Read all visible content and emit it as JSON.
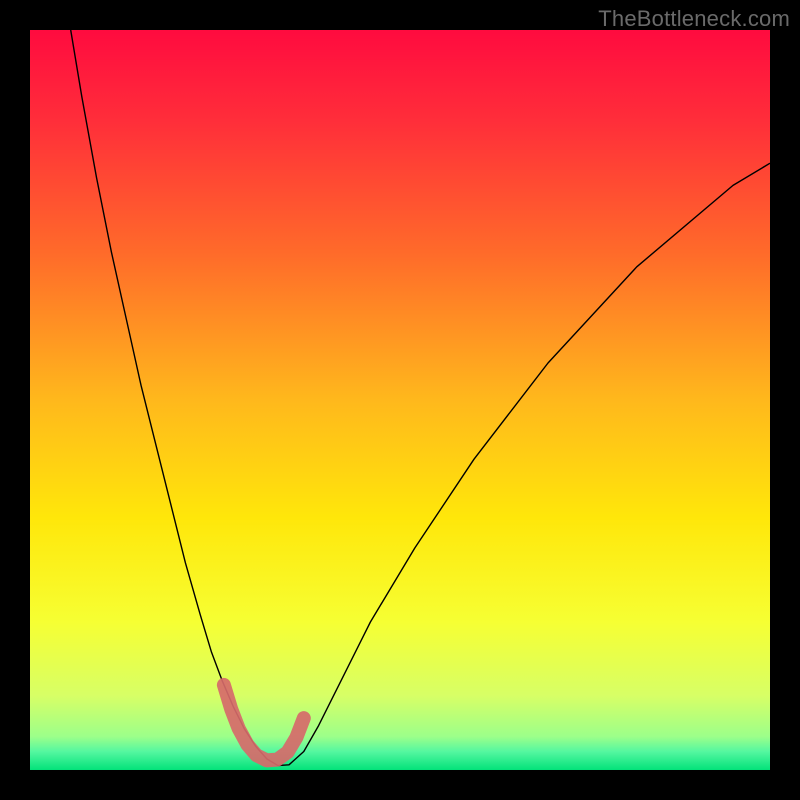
{
  "watermark": "TheBottleneck.com",
  "chart_data": {
    "type": "line",
    "title": "",
    "xlabel": "",
    "ylabel": "",
    "xlim": [
      0,
      100
    ],
    "ylim": [
      0,
      100
    ],
    "grid": false,
    "legend": false,
    "axes_visible": false,
    "background_gradient": {
      "stops": [
        {
          "offset": 0.0,
          "color": "#ff0b3f"
        },
        {
          "offset": 0.12,
          "color": "#ff2d3a"
        },
        {
          "offset": 0.3,
          "color": "#ff6a2a"
        },
        {
          "offset": 0.5,
          "color": "#ffb81c"
        },
        {
          "offset": 0.66,
          "color": "#ffe70a"
        },
        {
          "offset": 0.8,
          "color": "#f6ff33"
        },
        {
          "offset": 0.9,
          "color": "#d7ff66"
        },
        {
          "offset": 0.955,
          "color": "#9cff8a"
        },
        {
          "offset": 0.975,
          "color": "#55f7a0"
        },
        {
          "offset": 1.0,
          "color": "#03e27a"
        }
      ]
    },
    "series": [
      {
        "name": "bottleneck-curve",
        "color": "#000000",
        "stroke_width": 1.4,
        "x": [
          5.5,
          7,
          9,
          11,
          13,
          15,
          17,
          19,
          21,
          23,
          24.5,
          26,
          27.5,
          29,
          30.5,
          32,
          33.5,
          35,
          37,
          39,
          42,
          46,
          52,
          60,
          70,
          82,
          95,
          100
        ],
        "y": [
          100,
          91,
          80,
          70,
          61,
          52,
          44,
          36,
          28,
          21,
          16,
          12,
          8.5,
          5.5,
          3.2,
          1.5,
          0.6,
          0.7,
          2.5,
          6,
          12,
          20,
          30,
          42,
          55,
          68,
          79,
          82
        ]
      }
    ],
    "highlight_segment": {
      "name": "valley-highlight",
      "color": "#d66a6a",
      "stroke_width": 14,
      "linecap": "round",
      "x": [
        26.2,
        27.2,
        28.2,
        29.4,
        30.6,
        32.0,
        33.4,
        34.8,
        36.0,
        37.0
      ],
      "y": [
        11.5,
        8.2,
        5.6,
        3.4,
        2.0,
        1.3,
        1.4,
        2.4,
        4.4,
        7.0
      ]
    },
    "notes": "Values are approximate, read from an unlabeled plot. x and y are in percent of the plot area (0 at left/bottom, 100 at right/top). The curve is a V-shaped bottleneck profile with its minimum near x≈33. A thick salmon segment highlights the valley bottom."
  }
}
